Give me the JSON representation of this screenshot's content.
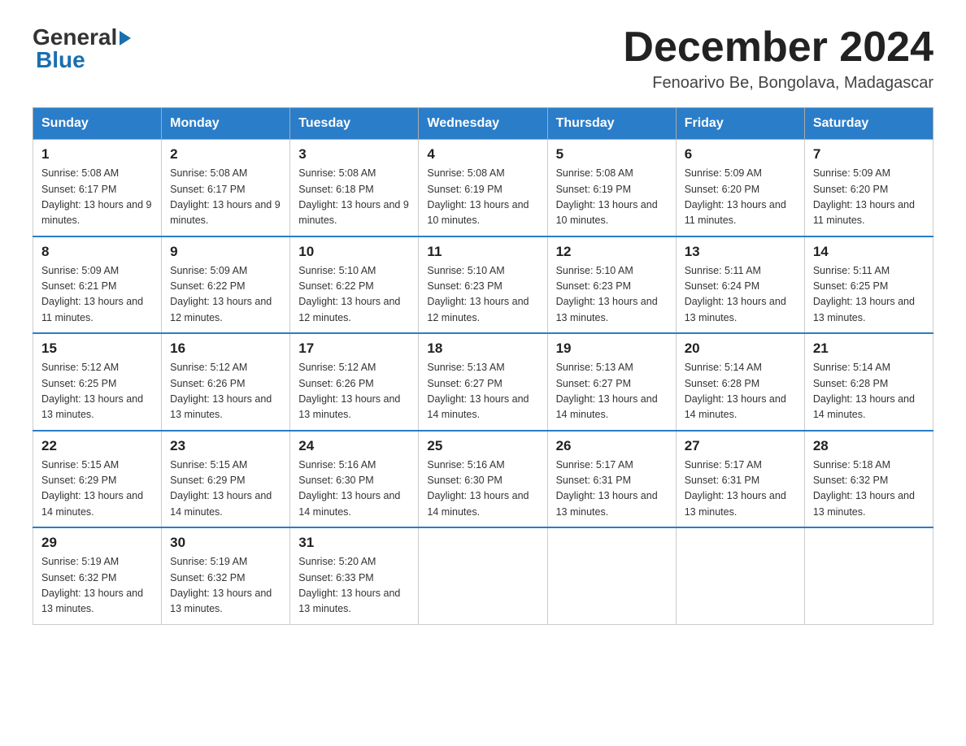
{
  "header": {
    "logo_general": "General",
    "logo_blue": "Blue",
    "month_title": "December 2024",
    "subtitle": "Fenoarivo Be, Bongolava, Madagascar"
  },
  "days_of_week": [
    "Sunday",
    "Monday",
    "Tuesday",
    "Wednesday",
    "Thursday",
    "Friday",
    "Saturday"
  ],
  "weeks": [
    [
      {
        "day": "1",
        "sunrise": "5:08 AM",
        "sunset": "6:17 PM",
        "daylight": "13 hours and 9 minutes."
      },
      {
        "day": "2",
        "sunrise": "5:08 AM",
        "sunset": "6:17 PM",
        "daylight": "13 hours and 9 minutes."
      },
      {
        "day": "3",
        "sunrise": "5:08 AM",
        "sunset": "6:18 PM",
        "daylight": "13 hours and 9 minutes."
      },
      {
        "day": "4",
        "sunrise": "5:08 AM",
        "sunset": "6:19 PM",
        "daylight": "13 hours and 10 minutes."
      },
      {
        "day": "5",
        "sunrise": "5:08 AM",
        "sunset": "6:19 PM",
        "daylight": "13 hours and 10 minutes."
      },
      {
        "day": "6",
        "sunrise": "5:09 AM",
        "sunset": "6:20 PM",
        "daylight": "13 hours and 11 minutes."
      },
      {
        "day": "7",
        "sunrise": "5:09 AM",
        "sunset": "6:20 PM",
        "daylight": "13 hours and 11 minutes."
      }
    ],
    [
      {
        "day": "8",
        "sunrise": "5:09 AM",
        "sunset": "6:21 PM",
        "daylight": "13 hours and 11 minutes."
      },
      {
        "day": "9",
        "sunrise": "5:09 AM",
        "sunset": "6:22 PM",
        "daylight": "13 hours and 12 minutes."
      },
      {
        "day": "10",
        "sunrise": "5:10 AM",
        "sunset": "6:22 PM",
        "daylight": "13 hours and 12 minutes."
      },
      {
        "day": "11",
        "sunrise": "5:10 AM",
        "sunset": "6:23 PM",
        "daylight": "13 hours and 12 minutes."
      },
      {
        "day": "12",
        "sunrise": "5:10 AM",
        "sunset": "6:23 PM",
        "daylight": "13 hours and 13 minutes."
      },
      {
        "day": "13",
        "sunrise": "5:11 AM",
        "sunset": "6:24 PM",
        "daylight": "13 hours and 13 minutes."
      },
      {
        "day": "14",
        "sunrise": "5:11 AM",
        "sunset": "6:25 PM",
        "daylight": "13 hours and 13 minutes."
      }
    ],
    [
      {
        "day": "15",
        "sunrise": "5:12 AM",
        "sunset": "6:25 PM",
        "daylight": "13 hours and 13 minutes."
      },
      {
        "day": "16",
        "sunrise": "5:12 AM",
        "sunset": "6:26 PM",
        "daylight": "13 hours and 13 minutes."
      },
      {
        "day": "17",
        "sunrise": "5:12 AM",
        "sunset": "6:26 PM",
        "daylight": "13 hours and 13 minutes."
      },
      {
        "day": "18",
        "sunrise": "5:13 AM",
        "sunset": "6:27 PM",
        "daylight": "13 hours and 14 minutes."
      },
      {
        "day": "19",
        "sunrise": "5:13 AM",
        "sunset": "6:27 PM",
        "daylight": "13 hours and 14 minutes."
      },
      {
        "day": "20",
        "sunrise": "5:14 AM",
        "sunset": "6:28 PM",
        "daylight": "13 hours and 14 minutes."
      },
      {
        "day": "21",
        "sunrise": "5:14 AM",
        "sunset": "6:28 PM",
        "daylight": "13 hours and 14 minutes."
      }
    ],
    [
      {
        "day": "22",
        "sunrise": "5:15 AM",
        "sunset": "6:29 PM",
        "daylight": "13 hours and 14 minutes."
      },
      {
        "day": "23",
        "sunrise": "5:15 AM",
        "sunset": "6:29 PM",
        "daylight": "13 hours and 14 minutes."
      },
      {
        "day": "24",
        "sunrise": "5:16 AM",
        "sunset": "6:30 PM",
        "daylight": "13 hours and 14 minutes."
      },
      {
        "day": "25",
        "sunrise": "5:16 AM",
        "sunset": "6:30 PM",
        "daylight": "13 hours and 14 minutes."
      },
      {
        "day": "26",
        "sunrise": "5:17 AM",
        "sunset": "6:31 PM",
        "daylight": "13 hours and 13 minutes."
      },
      {
        "day": "27",
        "sunrise": "5:17 AM",
        "sunset": "6:31 PM",
        "daylight": "13 hours and 13 minutes."
      },
      {
        "day": "28",
        "sunrise": "5:18 AM",
        "sunset": "6:32 PM",
        "daylight": "13 hours and 13 minutes."
      }
    ],
    [
      {
        "day": "29",
        "sunrise": "5:19 AM",
        "sunset": "6:32 PM",
        "daylight": "13 hours and 13 minutes."
      },
      {
        "day": "30",
        "sunrise": "5:19 AM",
        "sunset": "6:32 PM",
        "daylight": "13 hours and 13 minutes."
      },
      {
        "day": "31",
        "sunrise": "5:20 AM",
        "sunset": "6:33 PM",
        "daylight": "13 hours and 13 minutes."
      },
      null,
      null,
      null,
      null
    ]
  ]
}
